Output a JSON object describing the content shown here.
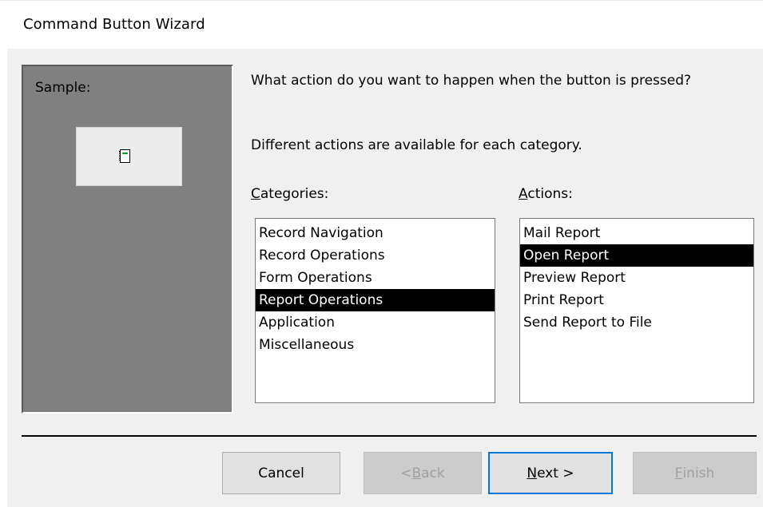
{
  "window": {
    "title": "Command Button Wizard"
  },
  "sample": {
    "label": "Sample:",
    "preview_icon": "form-icon"
  },
  "prompt": {
    "question": "What action do you want to happen when the button is pressed?",
    "hint": "Different actions are available for each category."
  },
  "categories": {
    "label_key": "C",
    "label_rest": "ategories:",
    "items": [
      "Record Navigation",
      "Record Operations",
      "Form Operations",
      "Report Operations",
      "Application",
      "Miscellaneous"
    ],
    "selected": "Report Operations"
  },
  "actions": {
    "label_key": "A",
    "label_rest": "ctions:",
    "items": [
      "Mail Report",
      "Open Report",
      "Preview Report",
      "Print Report",
      "Send Report to File"
    ],
    "selected": "Open Report"
  },
  "buttons": {
    "cancel": "Cancel",
    "back_pre": "< ",
    "back_key": "B",
    "back_rest": "ack",
    "next_key": "N",
    "next_rest": "ext >",
    "finish_key": "F",
    "finish_rest": "inish"
  },
  "colors": {
    "selection_bg": "#000000",
    "default_button_border": "#0078d7",
    "panel_gray": "#808080"
  }
}
